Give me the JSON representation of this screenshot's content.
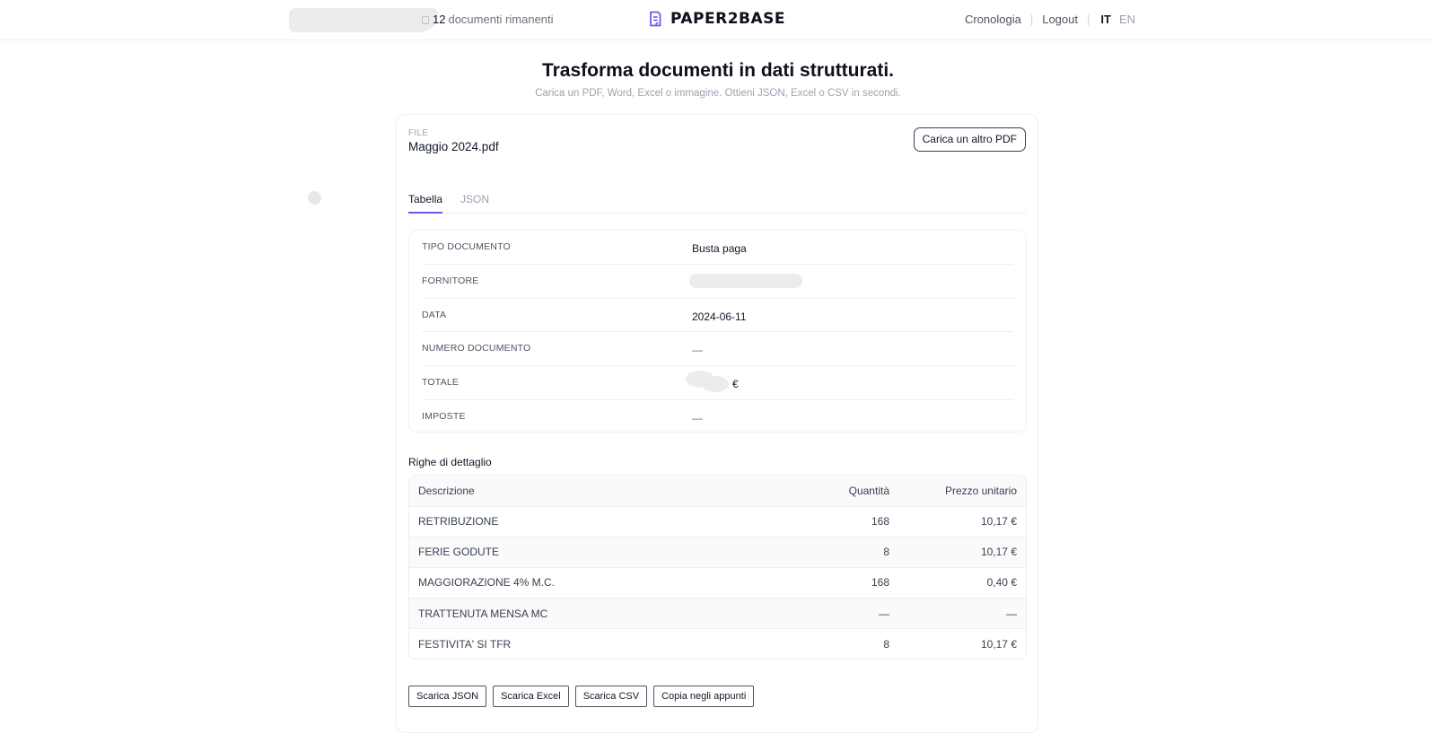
{
  "header": {
    "remaining_count": "12",
    "remaining_label": "documenti rimanenti",
    "logo_text": "PAPER2BASE",
    "nav": {
      "history": "Cronologia",
      "logout": "Logout",
      "lang_it": "IT",
      "lang_en": "EN"
    }
  },
  "hero": {
    "title": "Trasforma documenti in dati strutturati.",
    "subtitle": "Carica un PDF, Word, Excel o immagine. Ottieni JSON, Excel o CSV in secondi."
  },
  "file": {
    "label": "FILE",
    "name": "Maggio 2024.pdf",
    "upload_another": "Carica un altro PDF"
  },
  "tabs": [
    {
      "label": "Tabella",
      "active": true
    },
    {
      "label": "JSON",
      "active": false
    }
  ],
  "fields": {
    "doc_type": {
      "label": "TIPO DOCUMENTO",
      "value": "Busta paga"
    },
    "supplier": {
      "label": "FORNITORE"
    },
    "date": {
      "label": "DATA",
      "value": "2024-06-11"
    },
    "doc_number": {
      "label": "NUMERO DOCUMENTO",
      "value": "—"
    },
    "total": {
      "label": "TOTALE",
      "currency": "€"
    },
    "taxes": {
      "label": "IMPOSTE",
      "value": "—"
    }
  },
  "details": {
    "title": "Righe di dettaglio",
    "columns": [
      "Descrizione",
      "Quantità",
      "Prezzo unitario"
    ],
    "rows": [
      [
        "RETRIBUZIONE",
        "168",
        "10,17 €"
      ],
      [
        "FERIE GODUTE",
        "8",
        "10,17 €"
      ],
      [
        "MAGGIORAZIONE 4% M.C.",
        "168",
        "0,40 €"
      ],
      [
        "TRATTENUTA MENSA MC",
        "—",
        "—"
      ],
      [
        "FESTIVITA' SI TFR",
        "8",
        "10,17 €"
      ]
    ]
  },
  "actions": {
    "download_json": "Scarica JSON",
    "download_excel": "Scarica Excel",
    "download_csv": "Scarica CSV",
    "copy_clipboard": "Copia negli appunti"
  },
  "colors": {
    "accent": "#6d5ae6",
    "text": "#111827",
    "muted": "#9ca3af"
  }
}
